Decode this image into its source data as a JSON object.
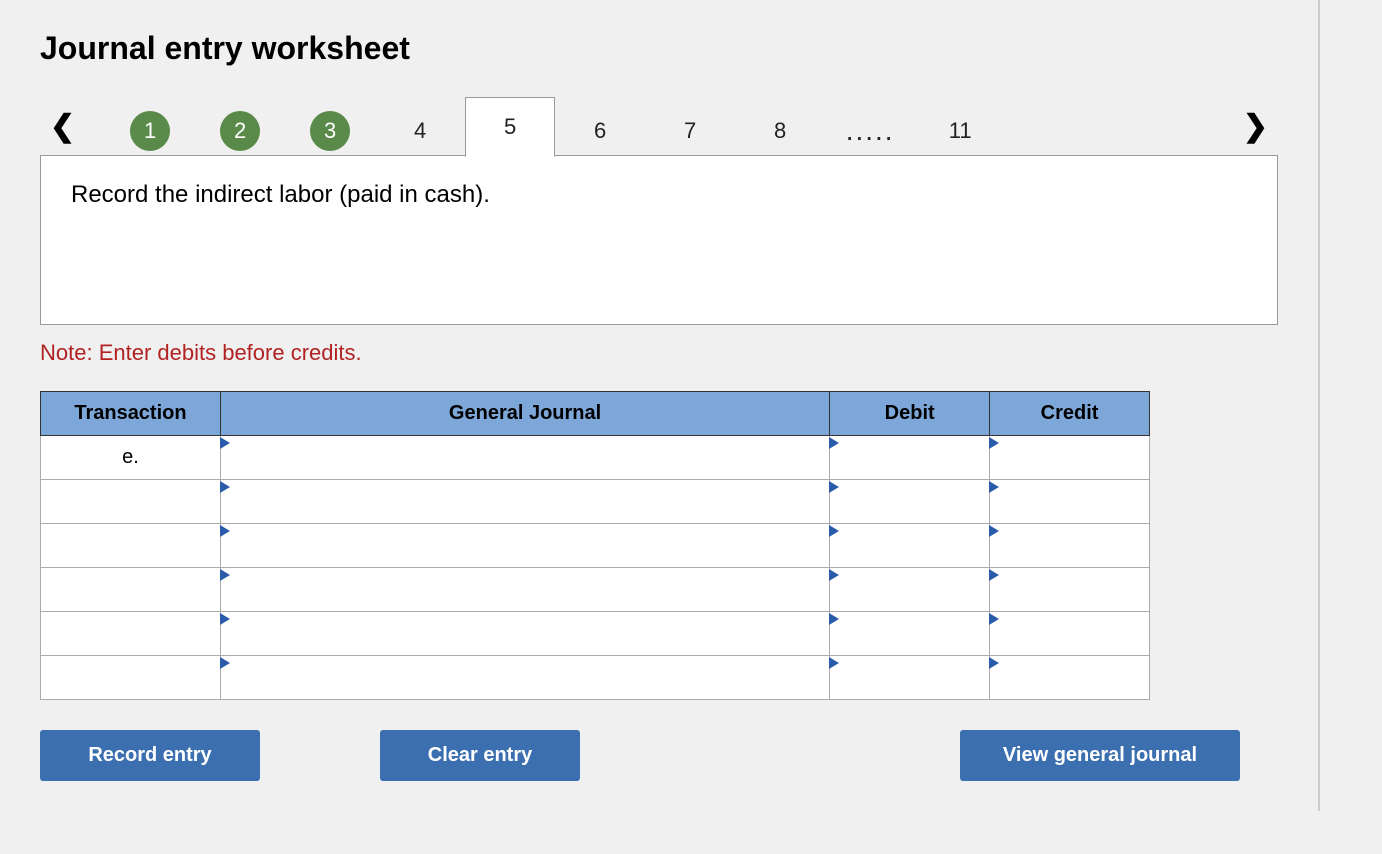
{
  "title": "Journal entry worksheet",
  "nav": {
    "prev_icon": "‹",
    "next_icon": "›",
    "tabs": [
      {
        "label": "1",
        "state": "completed"
      },
      {
        "label": "2",
        "state": "completed"
      },
      {
        "label": "3",
        "state": "completed"
      },
      {
        "label": "4",
        "state": "normal"
      },
      {
        "label": "5",
        "state": "active"
      },
      {
        "label": "6",
        "state": "normal"
      },
      {
        "label": "7",
        "state": "normal"
      },
      {
        "label": "8",
        "state": "normal"
      },
      {
        "label": ".....",
        "state": "ellipsis"
      },
      {
        "label": "11",
        "state": "normal"
      }
    ]
  },
  "instruction": "Record the indirect labor (paid in cash).",
  "note": "Note: Enter debits before credits.",
  "table": {
    "headers": {
      "transaction": "Transaction",
      "general_journal": "General Journal",
      "debit": "Debit",
      "credit": "Credit"
    },
    "rows": [
      {
        "transaction": "e.",
        "gj": "",
        "debit": "",
        "credit": ""
      },
      {
        "transaction": "",
        "gj": "",
        "debit": "",
        "credit": ""
      },
      {
        "transaction": "",
        "gj": "",
        "debit": "",
        "credit": ""
      },
      {
        "transaction": "",
        "gj": "",
        "debit": "",
        "credit": ""
      },
      {
        "transaction": "",
        "gj": "",
        "debit": "",
        "credit": ""
      },
      {
        "transaction": "",
        "gj": "",
        "debit": "",
        "credit": ""
      }
    ]
  },
  "buttons": {
    "record": "Record entry",
    "clear": "Clear entry",
    "view": "View general journal"
  }
}
